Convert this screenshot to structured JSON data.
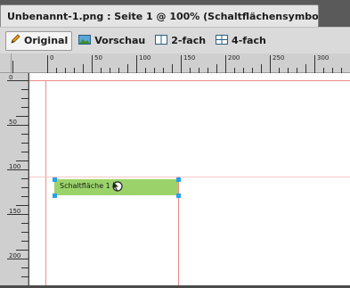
{
  "tab": {
    "title": "Unbenannt-1.png : Seite 1 @ 100% (Schaltflächensymbol)*",
    "close_glyph": "×"
  },
  "modes": [
    {
      "label": "Original",
      "icon": "pencil-icon",
      "active": true
    },
    {
      "label": "Vorschau",
      "icon": "image-preview-icon",
      "active": false
    },
    {
      "label": "2-fach",
      "icon": "two-up-icon",
      "active": false
    },
    {
      "label": "4-fach",
      "icon": "four-up-icon",
      "active": false
    }
  ],
  "rulers": {
    "top_labels": [
      "0",
      "50",
      "100",
      "150",
      "200",
      "250",
      "300"
    ],
    "left_labels": [
      "0",
      "50",
      "100",
      "150",
      "200"
    ]
  },
  "canvas": {
    "shape_label": "Schaltfläche 1",
    "shape_color": "#9bd36a",
    "guide_color": "#f08a8a",
    "handle_color": "#2aa0e8"
  }
}
